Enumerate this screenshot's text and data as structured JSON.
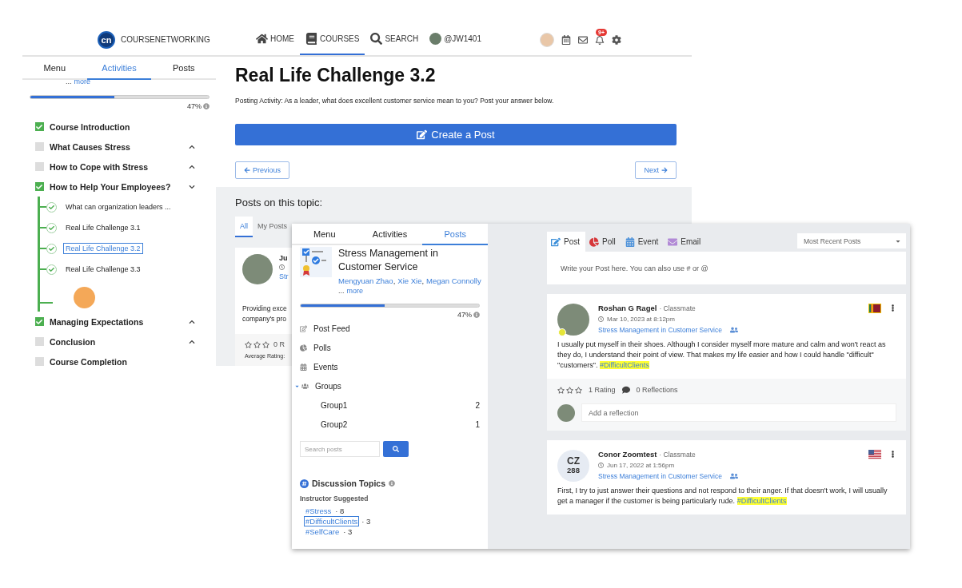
{
  "back_window": {
    "header": {
      "logo_mark": "cn",
      "logo_text": "COURSENETWORKING",
      "nav": [
        {
          "label": "HOME",
          "selected": false
        },
        {
          "label": "COURSES",
          "selected": true
        },
        {
          "label": "SEARCH",
          "selected": false
        },
        {
          "label": "@JW1401",
          "selected": false
        }
      ],
      "notification_count": "9+"
    },
    "sidebar": {
      "tabs": [
        {
          "label": "Menu",
          "selected": false
        },
        {
          "label": "Activities",
          "selected": true
        },
        {
          "label": "Posts",
          "selected": false
        }
      ],
      "ellipsis": "...",
      "more": "more",
      "progress": {
        "level": 0.47,
        "reading": "47%"
      },
      "outline": [
        {
          "title": "Course Introduction",
          "checked": true
        },
        {
          "title": "What Causes Stress",
          "checked": false,
          "expanded": false
        },
        {
          "title": "How to Cope with Stress",
          "checked": false,
          "expanded": false
        },
        {
          "title": "How to Help Your Employees?",
          "checked": true,
          "expanded": true,
          "children": [
            {
              "kind": "activity",
              "title": "What can organization leaders ...",
              "selected": false
            },
            {
              "kind": "activity",
              "title": "Real Life Challenge 3.1",
              "selected": false
            },
            {
              "kind": "activity",
              "title": "Real Life Challenge 3.2",
              "selected": true
            },
            {
              "kind": "activity",
              "title": "Real Life Challenge 3.3",
              "selected": false
            },
            {
              "kind": "badge"
            }
          ]
        },
        {
          "title": "Managing Expectations",
          "checked": true,
          "expanded": false
        },
        {
          "title": "Conclusion",
          "checked": false,
          "expanded": false
        },
        {
          "title": "Course Completion",
          "checked": false
        }
      ]
    },
    "main": {
      "title": "Real Life Challenge 3.2",
      "prompt": "Posting Activity: As a leader, what does excellent customer service mean to you? Post your answer below.",
      "create_button": "Create a Post",
      "previous": "Previous",
      "next": "Next",
      "posts_heading": "Posts on this topic:",
      "tabs": [
        {
          "label": "All",
          "selected": true
        },
        {
          "label": "My Posts",
          "selected": false
        }
      ],
      "post_preview": {
        "author": "Ju",
        "course": "Str",
        "body": [
          "Providing exce",
          "company's pro"
        ],
        "stars": 0,
        "rating": "0 R",
        "average": "Average Rating:"
      }
    }
  },
  "front_window": {
    "sidebar": {
      "tabs": [
        {
          "label": "Menu",
          "selected": false
        },
        {
          "label": "Activities",
          "selected": false
        },
        {
          "label": "Posts",
          "selected": true
        }
      ],
      "course_title": "Stress Management in Customer Service",
      "members": [
        "Mengyuan Zhao",
        "Xie Xie",
        "Megan Connolly"
      ],
      "separator": ",",
      "ellipsis": "...",
      "more": "more",
      "progress": {
        "level": 0.47,
        "reading": "47%"
      },
      "nav": [
        {
          "label": "Post Feed"
        },
        {
          "label": "Polls"
        },
        {
          "label": "Events"
        },
        {
          "label": "Groups",
          "expanded": true,
          "children": [
            {
              "label": "Group1",
              "count": "2"
            },
            {
              "label": "Group2",
              "count": "1"
            }
          ]
        }
      ],
      "search_placeholder": "Search posts",
      "topics_title": "Discussion Topics",
      "topics_subtitle": "Instructor Suggested",
      "topics": [
        {
          "tag": "#Stress",
          "count": "· 8",
          "selected": false
        },
        {
          "tag": "#DifficultClients",
          "count": "· 3",
          "selected": true
        },
        {
          "tag": "#SelfCare",
          "count": "· 3",
          "selected": false
        }
      ]
    },
    "composer": {
      "tabs": [
        {
          "label": "Post",
          "selected": true
        },
        {
          "label": "Poll",
          "selected": false
        },
        {
          "label": "Event",
          "selected": false
        },
        {
          "label": "Email",
          "selected": false
        }
      ],
      "sort": "Most Recent Posts",
      "placeholder": "Write your Post here. You can also use # or @"
    },
    "posts": [
      {
        "kind": "photo",
        "online": true,
        "author": "Roshan G Ragel",
        "role": "· Classmate",
        "date": "Mar 10, 2023 at 8:12pm",
        "course": "Stress Management in Customer Service",
        "body": "I usually put myself in their shoes. Although I consider myself more mature and calm and won't react as they do, I understand their point of view. That makes my life easier and how I could handle \"difficult\" \"customers\".",
        "hashtag": "#DifficultClients",
        "stars": 0,
        "rating": "1 Rating",
        "reflections": "0 Reflections",
        "reflection_placeholder": "Add a reflection"
      },
      {
        "kind": "initials",
        "initials": "CZ",
        "avatar_number": "288",
        "online": false,
        "author": "Conor Zoomtest",
        "role": "· Classmate",
        "date": "Jun 17, 2022 at 1:56pm",
        "course": "Stress Management in Customer Service",
        "body": "First, I try to just answer their questions and not respond to their anger. If that doesn't work, I will usually get a manager if the customer is being particularly rude.",
        "hashtag": "#DifficultClients"
      }
    ]
  }
}
